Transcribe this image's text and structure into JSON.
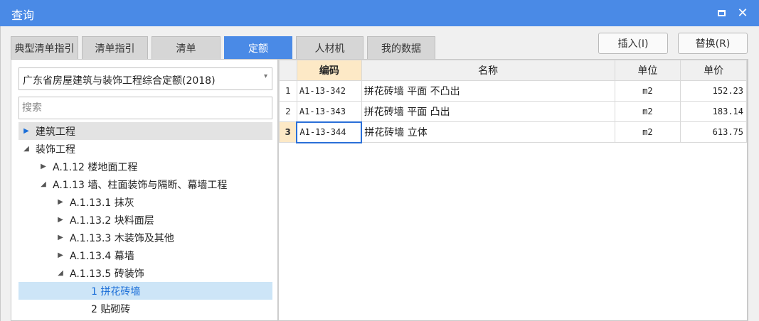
{
  "window": {
    "title": "查询",
    "max_icon": "maximize-icon",
    "close_glyph": "✕"
  },
  "tabs": [
    {
      "label": "典型清单指引",
      "active": false
    },
    {
      "label": "清单指引",
      "active": false
    },
    {
      "label": "清单",
      "active": false
    },
    {
      "label": "定额",
      "active": true
    },
    {
      "label": "人材机",
      "active": false
    },
    {
      "label": "我的数据",
      "active": false
    }
  ],
  "toolbar": {
    "insert_label": "插入(I)",
    "replace_label": "替换(R)"
  },
  "left": {
    "dropdown_value": "广东省房屋建筑与装饰工程综合定额(2018)",
    "search_placeholder": "搜索",
    "tree": [
      {
        "label": "建筑工程",
        "state": "collapsed"
      },
      {
        "label": "装饰工程",
        "state": "expanded"
      },
      {
        "label": "A.1.12 楼地面工程",
        "state": "collapsed"
      },
      {
        "label": "A.1.13 墙、柱面装饰与隔断、幕墙工程",
        "state": "expanded"
      },
      {
        "label": "A.1.13.1 抹灰",
        "state": "collapsed"
      },
      {
        "label": "A.1.13.2 块料面层",
        "state": "collapsed"
      },
      {
        "label": "A.1.13.3 木装饰及其他",
        "state": "collapsed"
      },
      {
        "label": "A.1.13.4 幕墙",
        "state": "collapsed"
      },
      {
        "label": "A.1.13.5 砖装饰",
        "state": "expanded"
      },
      {
        "label": "1 拼花砖墙",
        "state": "leaf"
      },
      {
        "label": "2 贴砌砖",
        "state": "leaf"
      }
    ]
  },
  "grid": {
    "columns": [
      "编码",
      "名称",
      "单位",
      "单价"
    ],
    "rows": [
      {
        "num": "1",
        "code": "A1-13-342",
        "name": "拼花砖墙 平面 不凸出",
        "unit": "m2",
        "price": "152.23"
      },
      {
        "num": "2",
        "code": "A1-13-343",
        "name": "拼花砖墙 平面 凸出",
        "unit": "m2",
        "price": "183.14"
      },
      {
        "num": "3",
        "code": "A1-13-344",
        "name": "拼花砖墙 立体",
        "unit": "m2",
        "price": "613.75"
      }
    ]
  },
  "colors": {
    "accent": "#4a8ae6",
    "selection": "#cde5f7",
    "header_active": "#fde9c6"
  }
}
